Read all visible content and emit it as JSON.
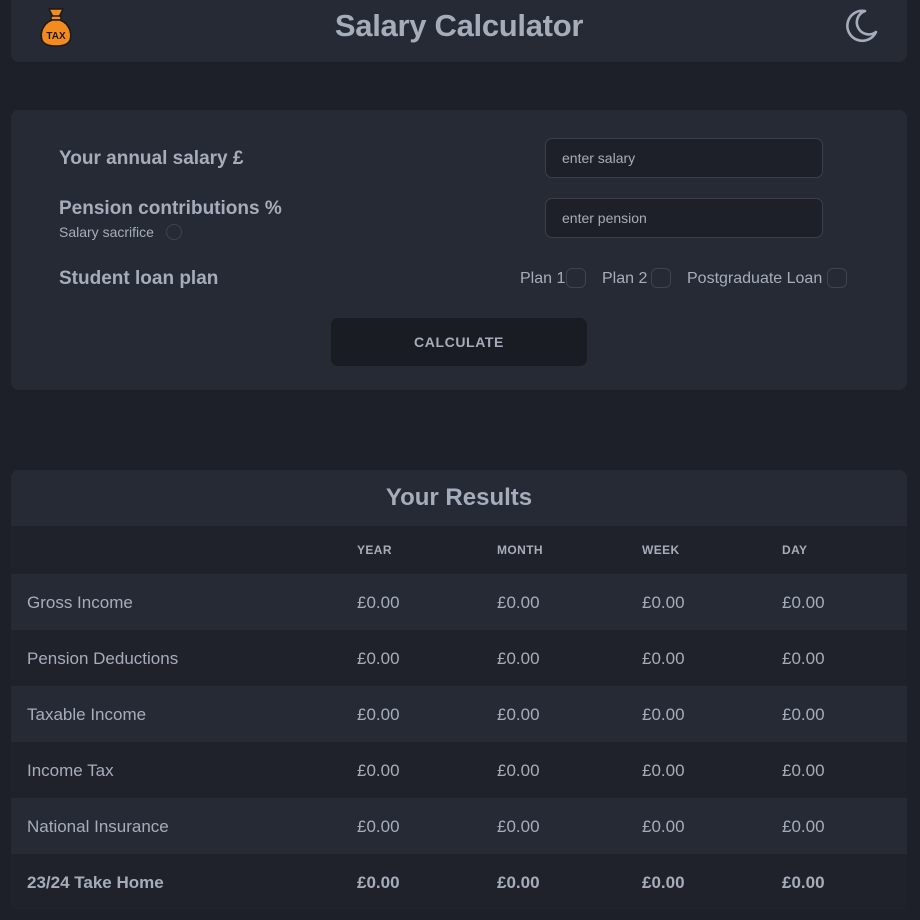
{
  "header": {
    "title": "Salary Calculator",
    "logo_text": "TAX",
    "logo_icon": "money-bag-icon",
    "theme_icon": "moon-icon"
  },
  "form": {
    "salary_label": "Your annual salary £",
    "salary_placeholder": "enter salary",
    "salary_value": "",
    "pension_label": "Pension contributions %",
    "pension_placeholder": "enter pension",
    "pension_value": "",
    "salary_sacrifice_label": "Salary sacrifice",
    "salary_sacrifice_checked": false,
    "loan_label": "Student loan plan",
    "loan_options": [
      {
        "label": "Plan 1",
        "checked": false
      },
      {
        "label": "Plan 2",
        "checked": false
      },
      {
        "label": "Postgraduate Loan",
        "checked": false
      }
    ],
    "calculate_label": "CALCULATE"
  },
  "results": {
    "title": "Your Results",
    "columns": [
      "",
      "YEAR",
      "MONTH",
      "WEEK",
      "DAY"
    ],
    "rows": [
      {
        "name": "Gross Income",
        "year": "£0.00",
        "month": "£0.00",
        "week": "£0.00",
        "day": "£0.00"
      },
      {
        "name": "Pension Deductions",
        "year": "£0.00",
        "month": "£0.00",
        "week": "£0.00",
        "day": "£0.00"
      },
      {
        "name": "Taxable Income",
        "year": "£0.00",
        "month": "£0.00",
        "week": "£0.00",
        "day": "£0.00"
      },
      {
        "name": "Income Tax",
        "year": "£0.00",
        "month": "£0.00",
        "week": "£0.00",
        "day": "£0.00"
      },
      {
        "name": "National Insurance",
        "year": "£0.00",
        "month": "£0.00",
        "week": "£0.00",
        "day": "£0.00"
      },
      {
        "name": "23/24 Take Home",
        "year": "£0.00",
        "month": "£0.00",
        "week": "£0.00",
        "day": "£0.00"
      }
    ]
  },
  "colors": {
    "background": "#1d2028",
    "card": "#262a35",
    "text": "#a6adba",
    "logo_bag": "#f38b1f"
  }
}
